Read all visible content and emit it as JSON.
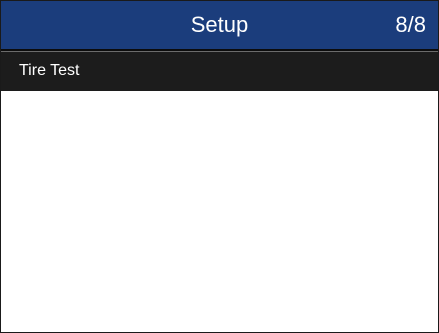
{
  "header": {
    "title": "Setup",
    "page_indicator": "8/8"
  },
  "menu": {
    "items": [
      {
        "label": "Tire Test",
        "selected": true
      }
    ]
  },
  "colors": {
    "header_background": "#1b3d7c",
    "selected_item_background": "#1c1c1c",
    "content_background": "#ffffff",
    "text": "#ffffff"
  }
}
